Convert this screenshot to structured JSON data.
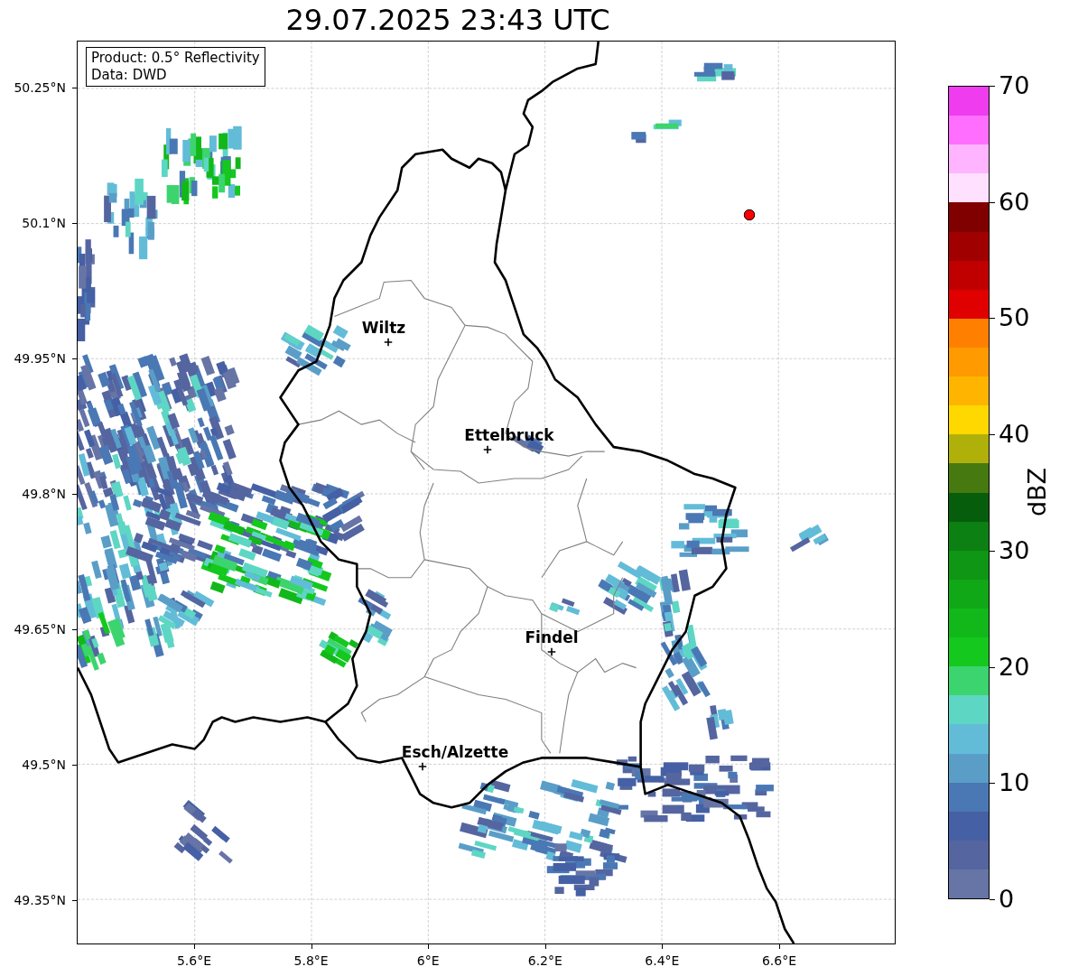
{
  "title": "29.07.2025 23:43 UTC",
  "info_box": [
    "Product: 0.5° Reflectivity",
    "Data: DWD"
  ],
  "y_ticks": [
    "50.25°N",
    "50.1°N",
    "49.95°N",
    "49.8°N",
    "49.65°N",
    "49.5°N",
    "49.35°N"
  ],
  "x_ticks": [
    "5.6°E",
    "5.8°E",
    "6°E",
    "6.2°E",
    "6.4°E",
    "6.6°E"
  ],
  "cities": [
    {
      "name": "Wiltz"
    },
    {
      "name": "Ettelbruck"
    },
    {
      "name": "Findel"
    },
    {
      "name": "Esch/Alzette"
    }
  ],
  "colorbar": {
    "label": "dBZ",
    "ticks": [
      "70",
      "60",
      "50",
      "40",
      "30",
      "20",
      "10",
      "0"
    ],
    "bands": [
      {
        "color": "#ee3cee"
      },
      {
        "color": "#ff6eff"
      },
      {
        "color": "#ffb4ff"
      },
      {
        "color": "#ffe0ff"
      },
      {
        "color": "#800000"
      },
      {
        "color": "#a00000"
      },
      {
        "color": "#c00000"
      },
      {
        "color": "#e00000"
      },
      {
        "color": "#ff8000"
      },
      {
        "color": "#ff9a00"
      },
      {
        "color": "#ffb400"
      },
      {
        "color": "#ffd800"
      },
      {
        "color": "#b0b00a"
      },
      {
        "color": "#467a10"
      },
      {
        "color": "#065e0c"
      },
      {
        "color": "#0c8012"
      },
      {
        "color": "#0e9614"
      },
      {
        "color": "#10a816"
      },
      {
        "color": "#12b81a"
      },
      {
        "color": "#14c81e"
      },
      {
        "color": "#3cd46e"
      },
      {
        "color": "#5ed6c4"
      },
      {
        "color": "#62bcd8"
      },
      {
        "color": "#5a9ec8"
      },
      {
        "color": "#4a78b4"
      },
      {
        "color": "#4560a4"
      },
      {
        "color": "#5565a0"
      },
      {
        "color": "#6674a6"
      }
    ]
  }
}
